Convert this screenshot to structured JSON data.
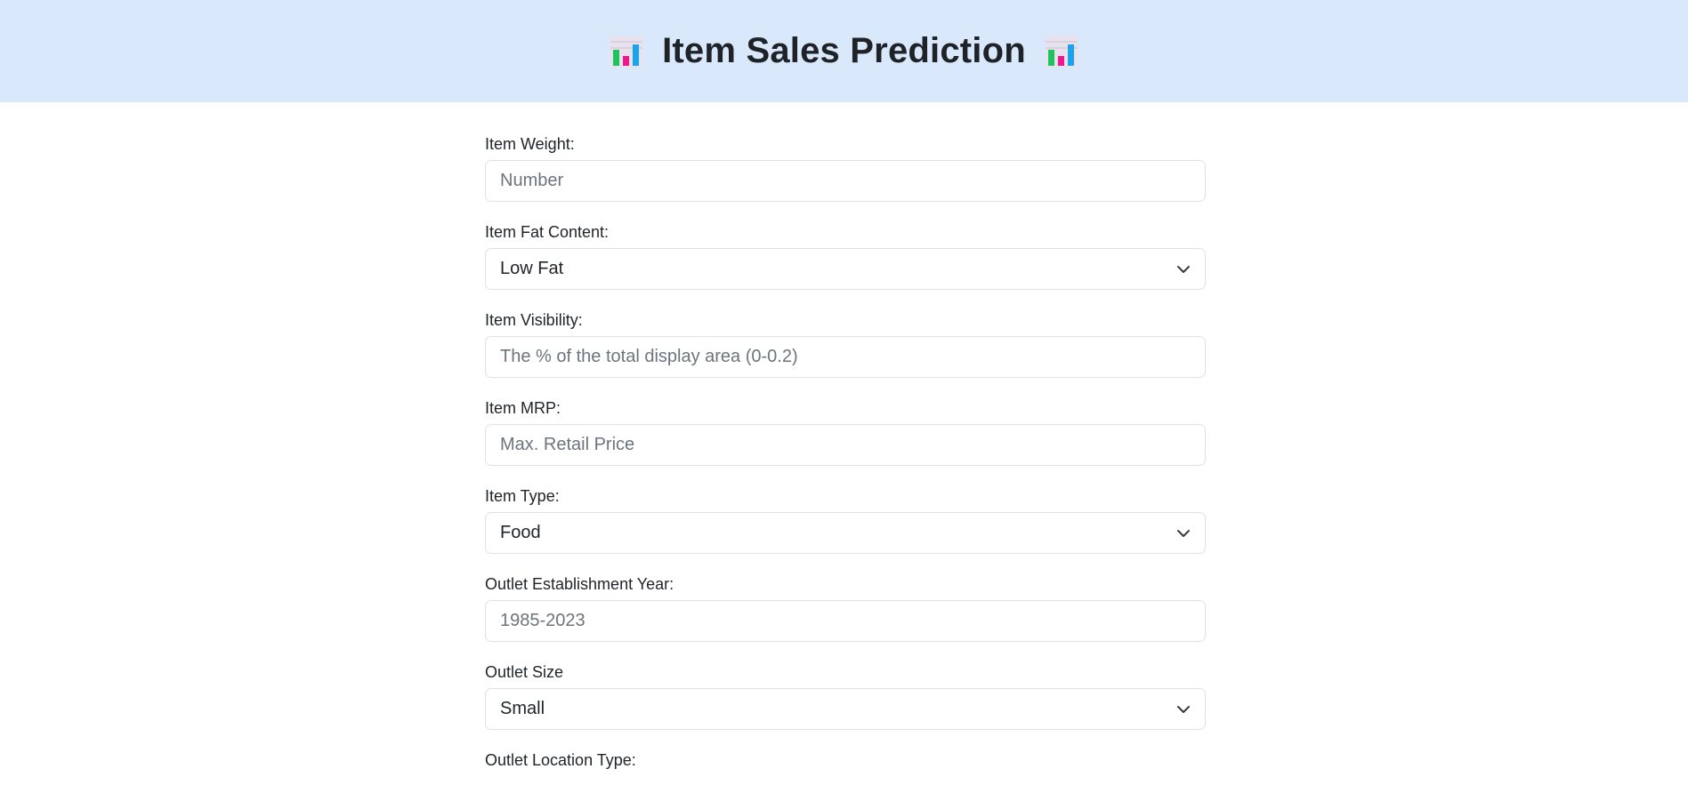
{
  "header": {
    "title": "Item Sales Prediction",
    "left_icon": "bar-chart-icon",
    "right_icon": "bar-chart-icon",
    "background": "#d9e8fb"
  },
  "form": {
    "item_weight": {
      "label": "Item Weight:",
      "placeholder": "Number",
      "value": ""
    },
    "item_fat_content": {
      "label": "Item Fat Content:",
      "selected": "Low Fat"
    },
    "item_visibility": {
      "label": "Item Visibility:",
      "placeholder": "The % of the total display area (0-0.2)",
      "value": ""
    },
    "item_mrp": {
      "label": "Item MRP:",
      "placeholder": "Max. Retail Price",
      "value": ""
    },
    "item_type": {
      "label": "Item Type:",
      "selected": "Food"
    },
    "outlet_establishment_year": {
      "label": "Outlet Establishment Year:",
      "placeholder": "1985-2023",
      "value": ""
    },
    "outlet_size": {
      "label": "Outlet Size",
      "selected": "Small"
    },
    "outlet_location_type": {
      "label": "Outlet Location Type:"
    }
  }
}
